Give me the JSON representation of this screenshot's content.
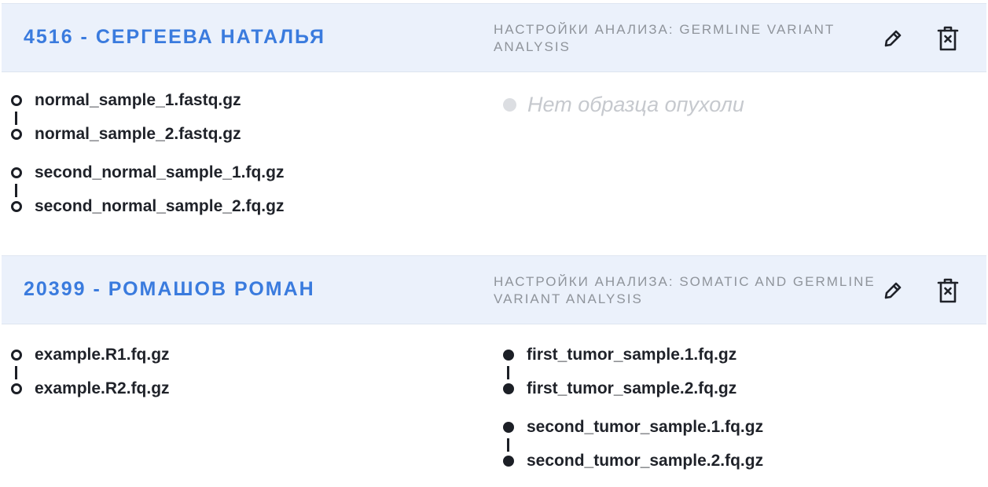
{
  "cards": [
    {
      "title": "4516 - СЕРГЕЕВА НАТАЛЬЯ",
      "settings": "НАСТРОЙКИ АНАЛИЗА: GERMLINE VARIANT ANALYSIS",
      "normal_pairs": [
        [
          "normal_sample_1.fastq.gz",
          "normal_sample_2.fastq.gz"
        ],
        [
          "second_normal_sample_1.fq.gz",
          "second_normal_sample_2.fq.gz"
        ]
      ],
      "tumor_placeholder": "Нет образца опухоли"
    },
    {
      "title": "20399 - РОМАШОВ РОМАН",
      "settings": "НАСТРОЙКИ АНАЛИЗА: SOMATIC AND GERMLINE VARIANT ANALYSIS",
      "normal_pairs": [
        [
          "example.R1.fq.gz",
          "example.R2.fq.gz"
        ]
      ],
      "tumor_pairs": [
        [
          "first_tumor_sample.1.fq.gz",
          "first_tumor_sample.2.fq.gz"
        ],
        [
          "second_tumor_sample.1.fq.gz",
          "second_tumor_sample.2.fq.gz"
        ]
      ]
    }
  ],
  "icons": {
    "edit": "pencil-icon",
    "delete": "trash-icon"
  },
  "colors": {
    "title": "#3a7bde",
    "header_bg": "#ebf1fb",
    "settings_text": "#8f949b"
  }
}
